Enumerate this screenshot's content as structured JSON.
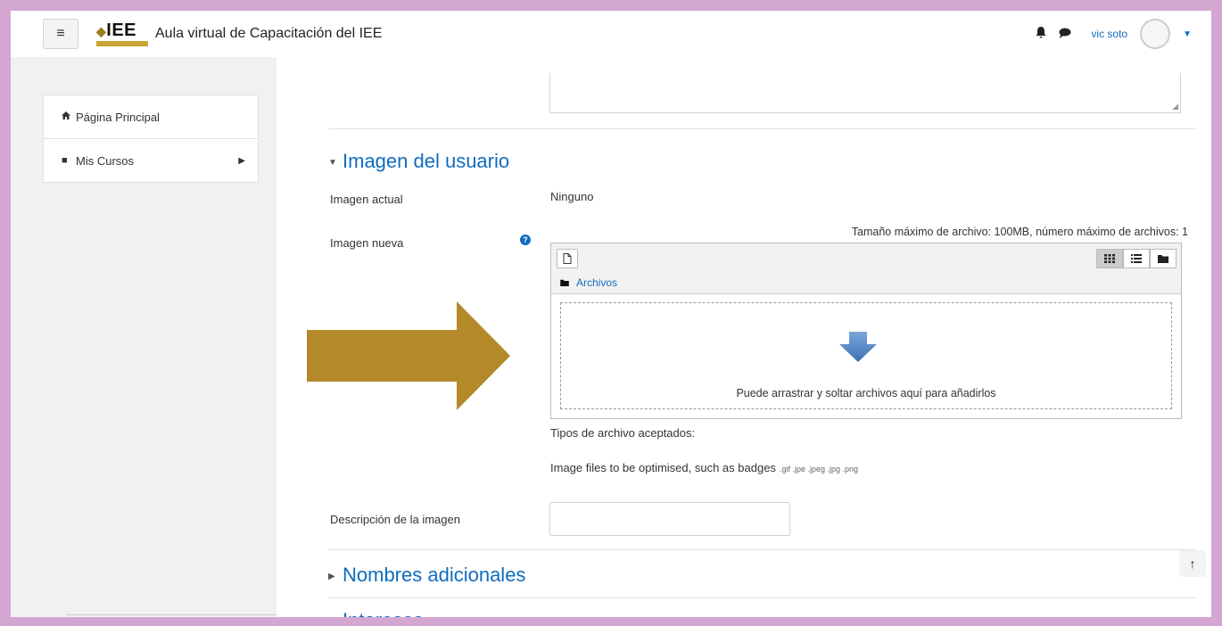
{
  "navbar": {
    "logo_text": "IEE",
    "site_name": "Aula virtual de Capacitación del IEE",
    "user_name": "vic soto",
    "icons": [
      "menu-icon",
      "bell-icon",
      "chat-icon",
      "avatar",
      "caret-down-icon"
    ]
  },
  "drawer": {
    "items": [
      {
        "label": "Página Principal",
        "icon": "home-icon"
      },
      {
        "label": "Mis Cursos",
        "icon": "square-icon",
        "has_submenu": true
      }
    ]
  },
  "section_image": {
    "title": "Imagen del usuario",
    "current_label": "Imagen actual",
    "current_value": "Ninguno",
    "new_label": "Imagen nueva",
    "max_size_text": "Tamaño máximo de archivo: 100MB, número máximo de archivos: 1",
    "path_label": "Archivos",
    "drop_text": "Puede arrastrar y soltar archivos aquí para añadirlos",
    "accepted_types_label": "Tipos de archivo aceptados:",
    "accepted_types_text": "Image files to be optimised, such as badges",
    "accepted_types_ext": ".gif .jpe .jpeg .jpg .png",
    "description_label": "Descripción de la imagen",
    "description_value": ""
  },
  "sections_collapsed": [
    {
      "title": "Nombres adicionales"
    },
    {
      "title": "Intereses"
    }
  ],
  "colors": {
    "frame_border": "#d3a7d2",
    "link_blue": "#0f6cbf",
    "annotation_arrow": "#b3892a",
    "drop_arrow": "#4a7fc1"
  }
}
